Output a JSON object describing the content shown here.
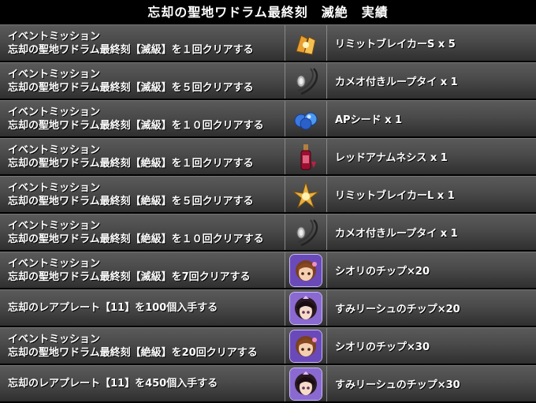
{
  "title": "忘却の聖地ワドラム最終刻　滅絶　実績",
  "rows": [
    {
      "line1": "イベントミッション",
      "line2": "忘却の聖地ワドラム最終刻【滅級】を１回クリアする",
      "icon": "limit-breaker-s-icon",
      "reward": "リミットブレイカーS x 5"
    },
    {
      "line1": "イベントミッション",
      "line2": "忘却の聖地ワドラム最終刻【滅級】を５回クリアする",
      "icon": "cameo-loop-tie-icon",
      "reward": "カメオ付きループタイ x 1"
    },
    {
      "line1": "イベントミッション",
      "line2": "忘却の聖地ワドラム最終刻【滅級】を１０回クリアする",
      "icon": "ap-seed-icon",
      "reward": "APシード x 1"
    },
    {
      "line1": "イベントミッション",
      "line2": "忘却の聖地ワドラム最終刻【絶級】を１回クリアする",
      "icon": "red-anamnesis-icon",
      "reward": "レッドアナムネシス x 1"
    },
    {
      "line1": "イベントミッション",
      "line2": "忘却の聖地ワドラム最終刻【絶級】を５回クリアする",
      "icon": "limit-breaker-l-icon",
      "reward": "リミットブレイカーL x 1"
    },
    {
      "line1": "イベントミッション",
      "line2": "忘却の聖地ワドラム最終刻【絶級】を１０回クリアする",
      "icon": "cameo-loop-tie-icon",
      "reward": "カメオ付きループタイ x 1"
    },
    {
      "line1": "イベントミッション",
      "line2": "忘却の聖地ワドラム最終刻【滅級】を7回クリアする",
      "icon": "shiori-chip-icon",
      "reward": "シオリのチップ×20"
    },
    {
      "line1": "",
      "line2": "忘却のレアプレート【11】を100個入手する",
      "icon": "sumi-risha-chip-icon",
      "reward": "すみリーシュのチップ×20"
    },
    {
      "line1": "イベントミッション",
      "line2": "忘却の聖地ワドラム最終刻【絶級】を20回クリアする",
      "icon": "shiori-chip-icon",
      "reward": "シオリのチップ×30"
    },
    {
      "line1": "",
      "line2": "忘却のレアプレート【11】を450個入手する",
      "icon": "sumi-risha-chip-icon",
      "reward": "すみリーシュのチップ×30"
    }
  ]
}
